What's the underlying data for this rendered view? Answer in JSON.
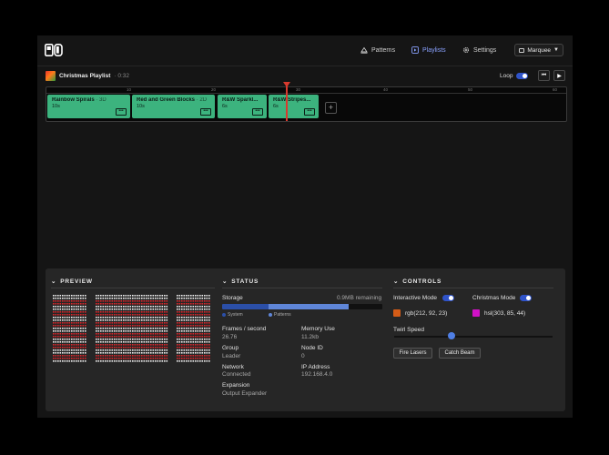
{
  "nav": {
    "patterns": "Patterns",
    "playlists": "Playlists",
    "settings": "Settings",
    "device": "Marquee"
  },
  "playlist": {
    "title": "Christmas Playlist",
    "duration": "· 0:32",
    "loop_label": "Loop"
  },
  "timeline": {
    "ticks": [
      "10",
      "20",
      "30",
      "40",
      "50",
      "60"
    ],
    "clips": [
      {
        "name": "Rainbow Spirals",
        "type": "· 3D",
        "dur": "10s"
      },
      {
        "name": "Red and Green Blocks",
        "type": "· 2D",
        "dur": "10s"
      },
      {
        "name": "R&W Sparkl...",
        "type": "",
        "dur": "6s"
      },
      {
        "name": "R&W Stripes...",
        "type": "",
        "dur": "6s"
      }
    ]
  },
  "preview": {
    "heading": "PREVIEW"
  },
  "status": {
    "heading": "STATUS",
    "storage_label": "Storage",
    "storage_remaining": "0.9MB remaining",
    "storage_system_fraction": 0.29,
    "storage_patterns_fraction": 0.5,
    "legend_system": "System",
    "legend_patterns": "Patterns",
    "fps_label": "Frames / second",
    "fps_value": "26.76",
    "memory_label": "Memory Use",
    "memory_value": "11.2kb",
    "group_label": "Group",
    "group_value": "Leader",
    "nodeid_label": "Node ID",
    "nodeid_value": "0",
    "network_label": "Network",
    "network_value": "Connected",
    "ip_label": "IP Address",
    "ip_value": "192.168.4.0",
    "expansion_label": "Expansion",
    "expansion_value": "Output Expander"
  },
  "controls": {
    "heading": "CONTROLS",
    "interactive_label": "Interactive Mode",
    "christmas_label": "Christmas Mode",
    "color1_text": "rgb(212, 92, 23)",
    "color1": "#d45c17",
    "color2_text": "hsl(303, 85, 44)",
    "color2": "#d011c6",
    "twirl_label": "Twirl Speed",
    "twirl_value": 0.36,
    "fire_lasers": "Fire Lasers",
    "catch_beam": "Catch Beam"
  },
  "colors": {
    "accent": "#2f53c9",
    "clip": "#3cb37e",
    "playhead": "#d83a2e"
  }
}
